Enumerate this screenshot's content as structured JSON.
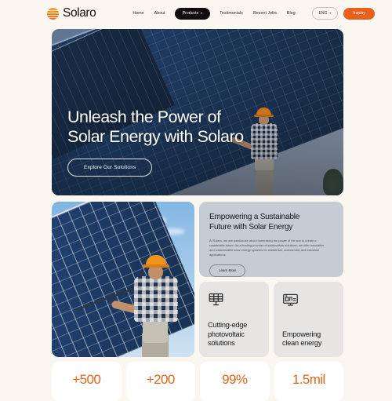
{
  "brand": {
    "name": "Solaro",
    "logo_icon": "sun-stripes-icon",
    "accent": "#E8601A"
  },
  "nav": {
    "links": [
      {
        "label": "Home"
      },
      {
        "label": "About"
      }
    ],
    "pill": {
      "label": "Products",
      "caret": "▾"
    },
    "links_after": [
      {
        "label": "Testimonials"
      },
      {
        "label": "Recent Jobs"
      },
      {
        "label": "Blog"
      }
    ],
    "language": {
      "label": "ENG",
      "caret": "▾"
    },
    "inquiry": {
      "label": "Inquiry"
    }
  },
  "hero": {
    "title_line1": "Unleash the Power of",
    "title_line2": "Solar Energy with Solaro",
    "cta": "Explore Our Solutions",
    "image_alt": "solar-technician-on-panel-array"
  },
  "mid": {
    "photo_alt": "worker-installing-solar-panels",
    "info": {
      "title_line1": "Empowering a Sustainable",
      "title_line2": "Future with Solar Energy",
      "body": "At Solaro, we are passionate about harnessing the power of the sun to create a sustainable future. As a leading provider of photovoltaic solutions, we offer innovative and customizable solar energy systems for residential, commercial, and industrial applications.",
      "button": "Learn More"
    },
    "features": [
      {
        "icon": "solar-panel-grid-icon",
        "label": "Cutting-edge photovoltaic solutions"
      },
      {
        "icon": "monitor-clean-energy-icon",
        "label": "Empowering clean energy"
      }
    ]
  },
  "stats": [
    {
      "value": "+500"
    },
    {
      "value": "+200"
    },
    {
      "value": "99%"
    },
    {
      "value": "1.5mil"
    }
  ]
}
